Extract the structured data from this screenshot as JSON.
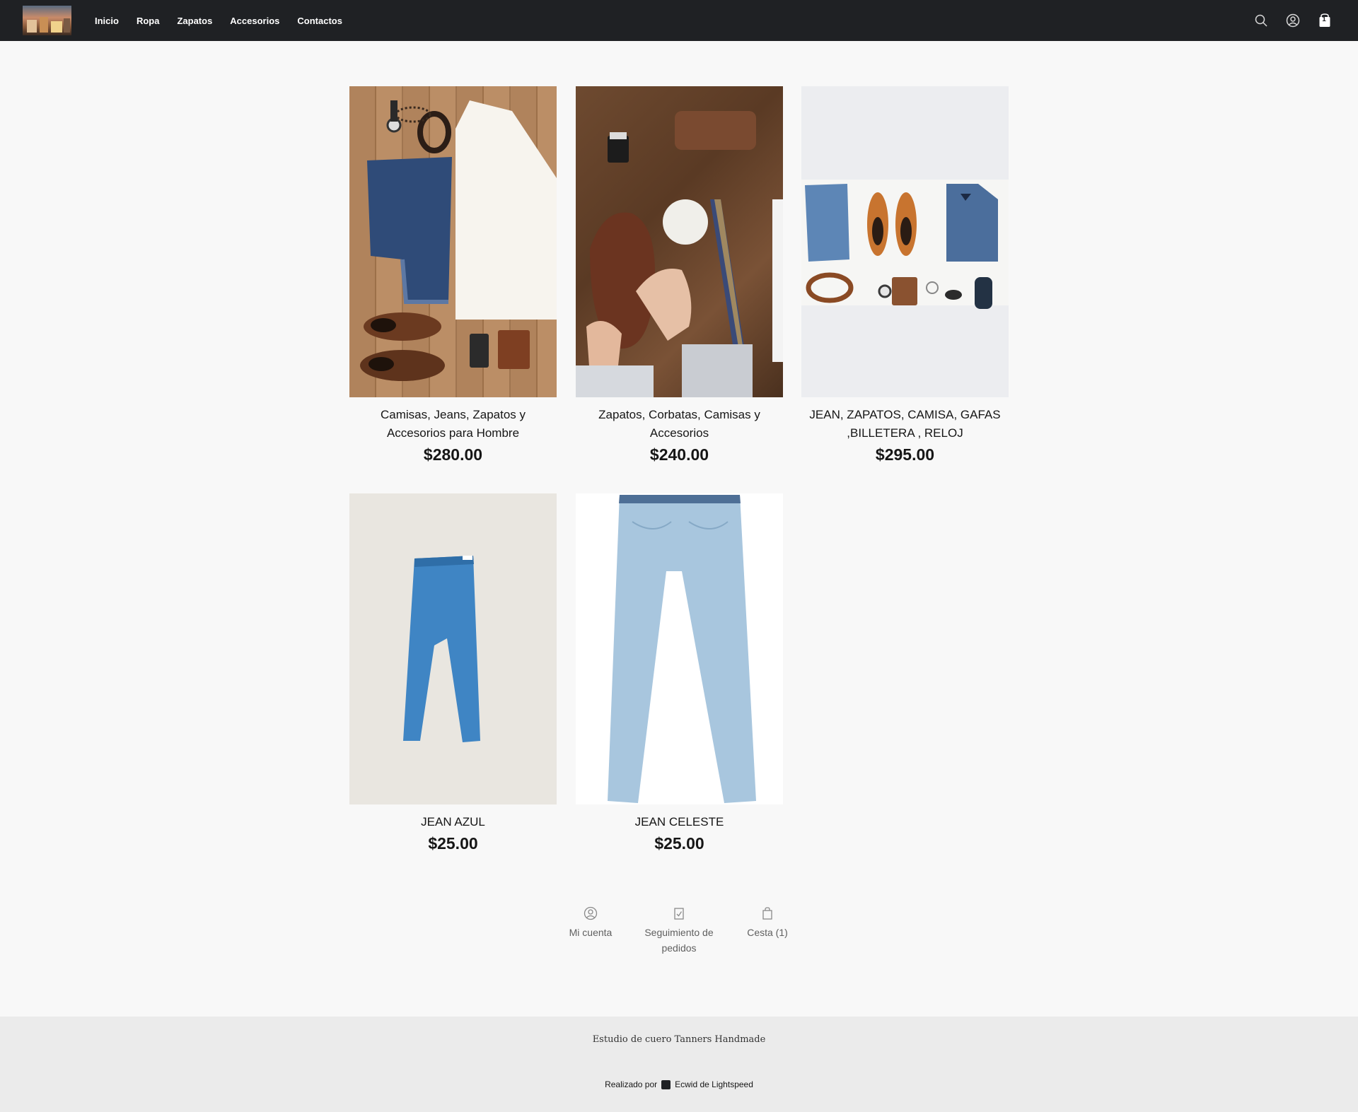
{
  "header": {
    "nav": [
      "Inicio",
      "Ropa",
      "Zapatos",
      "Accesorios",
      "Contactos"
    ],
    "cart_count": "1",
    "icons": [
      "search-icon",
      "account-icon",
      "cart-icon"
    ],
    "background_color": "#1f2124"
  },
  "products": [
    {
      "title": "Camisas, Jeans, Zapatos y Accesorios para Hombre",
      "price": "$280.00"
    },
    {
      "title": "Zapatos, Corbatas, Camisas y Accesorios",
      "price": "$240.00"
    },
    {
      "title": "JEAN, ZAPATOS, CAMISA, GAFAS ,BILLETERA , RELOJ",
      "price": "$295.00"
    },
    {
      "title": "JEAN AZUL",
      "price": "$25.00"
    },
    {
      "title": "JEAN CELESTE",
      "price": "$25.00"
    }
  ],
  "footer_links": [
    {
      "label": "Mi cuenta",
      "icon": "account-icon"
    },
    {
      "label": "Seguimiento de pedidos",
      "icon": "order-tracking-icon"
    },
    {
      "label": "Cesta (1)",
      "icon": "bag-icon"
    }
  ],
  "footer": {
    "store_name": "Estudio de cuero Tanners Handmade",
    "powered_prefix": "Realizado por",
    "powered_brand": "Ecwid de Lightspeed"
  }
}
